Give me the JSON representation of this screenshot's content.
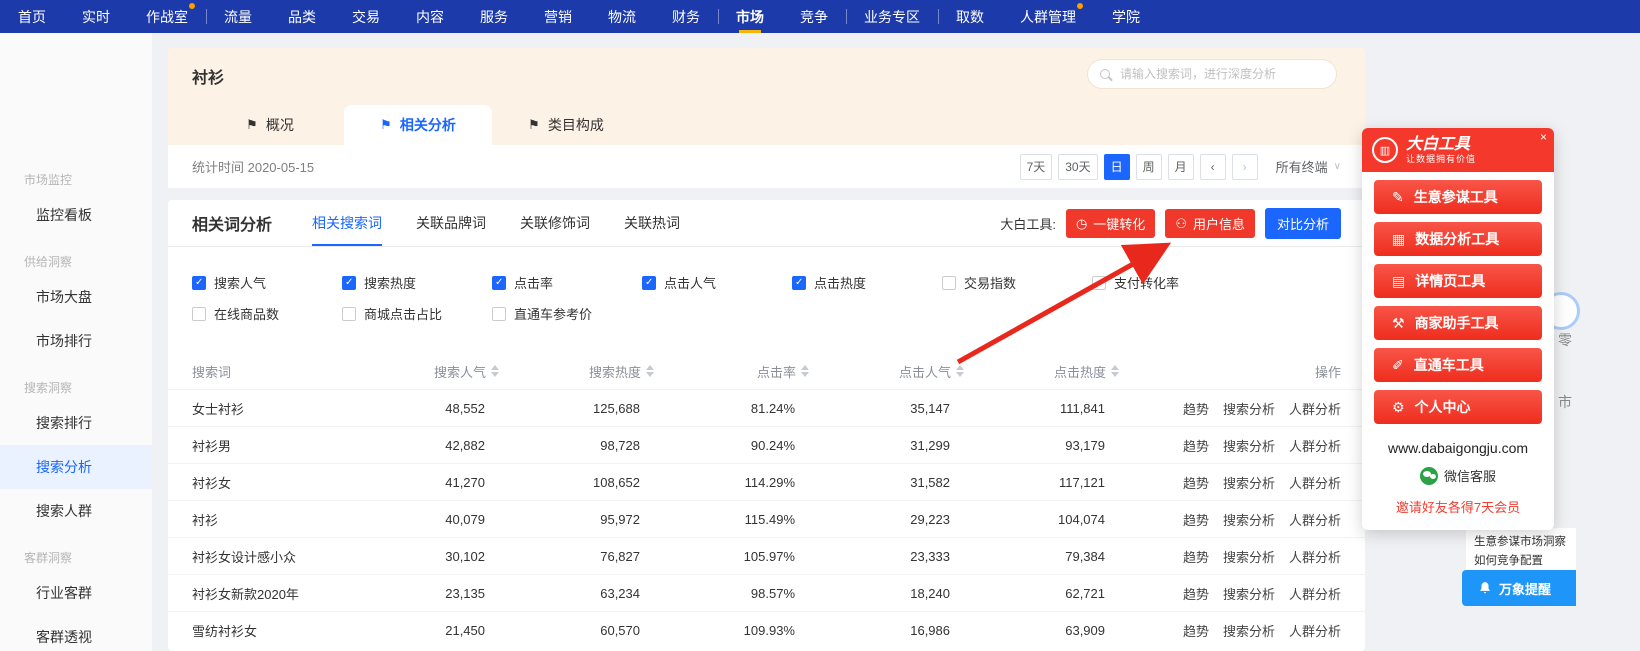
{
  "topnav": {
    "items": [
      {
        "label": "首页"
      },
      {
        "label": "实时"
      },
      {
        "label": "作战室",
        "badge": true
      },
      {
        "label": "流量",
        "divider": true
      },
      {
        "label": "品类"
      },
      {
        "label": "交易"
      },
      {
        "label": "内容"
      },
      {
        "label": "服务"
      },
      {
        "label": "营销"
      },
      {
        "label": "物流"
      },
      {
        "label": "财务"
      },
      {
        "label": "市场",
        "divider": true,
        "active": true
      },
      {
        "label": "竞争"
      },
      {
        "label": "业务专区",
        "divider": true
      },
      {
        "label": "取数",
        "divider": true
      },
      {
        "label": "人群管理",
        "badge": true
      },
      {
        "label": "学院"
      }
    ]
  },
  "sidebar": {
    "rows": [
      {
        "label": "市场监控",
        "is_header": true,
        "inter": "false"
      },
      {
        "label": "监控看板",
        "inter": "true"
      },
      {
        "label": "供给洞察",
        "is_header": true,
        "inter": "false"
      },
      {
        "label": "市场大盘",
        "inter": "true"
      },
      {
        "label": "市场排行",
        "inter": "true"
      },
      {
        "label": "搜索洞察",
        "is_header": true,
        "inter": "false"
      },
      {
        "label": "搜索排行",
        "inter": "true"
      },
      {
        "label": "搜索分析",
        "active": true,
        "inter": "true"
      },
      {
        "label": "搜索人群",
        "inter": "true"
      },
      {
        "label": "客群洞察",
        "is_header": true,
        "inter": "false"
      },
      {
        "label": "行业客群",
        "inter": "true"
      },
      {
        "label": "客群透视",
        "inter": "true"
      }
    ]
  },
  "hero": {
    "keyword": "衬衫",
    "search_placeholder": "请输入搜索词，进行深度分析",
    "tab_flag_glyph": "⚑",
    "tabs": [
      {
        "label": "概况"
      },
      {
        "label": "相关分析",
        "active": true
      },
      {
        "label": "类目构成"
      }
    ]
  },
  "toolbar": {
    "stat_time": "统计时间 2020-05-15",
    "date_buttons": [
      {
        "label": "7天"
      },
      {
        "label": "30天"
      },
      {
        "label": "日",
        "active": true
      },
      {
        "label": "周"
      },
      {
        "label": "月"
      }
    ],
    "prev_glyph": "‹",
    "next_glyph": "›",
    "terminal": "所有终端",
    "caret_glyph": "∨"
  },
  "analysis": {
    "title": "相关词分析",
    "tabs": [
      {
        "label": "相关搜索词",
        "active": true
      },
      {
        "label": "关联品牌词"
      },
      {
        "label": "关联修饰词"
      },
      {
        "label": "关联热词"
      }
    ],
    "tools_label": "大白工具:",
    "tools": [
      {
        "label": "一键转化",
        "name": "one-key-convert-button",
        "icon_name": "one-key-convert-icon",
        "icon_glyph": "◷",
        "has_icon": true
      },
      {
        "label": "用户信息",
        "name": "user-info-button",
        "icon_name": "user-info-icon",
        "icon_glyph": "⚇",
        "has_icon": true
      },
      {
        "label": "对比分析",
        "name": "compare-analysis-button",
        "is_blue": true
      }
    ],
    "metrics": [
      {
        "label": "搜索人气",
        "checked": true
      },
      {
        "label": "搜索热度",
        "checked": true
      },
      {
        "label": "点击率",
        "checked": true
      },
      {
        "label": "点击人气",
        "checked": true
      },
      {
        "label": "点击热度",
        "checked": true
      },
      {
        "label": "交易指数"
      },
      {
        "label": "支付转化率"
      },
      {
        "label": "在线商品数"
      },
      {
        "label": "商城点击占比"
      },
      {
        "label": "直通车参考价"
      }
    ]
  },
  "table": {
    "columns": [
      {
        "label": "搜索词"
      },
      {
        "label": "搜索人气",
        "sortable": true
      },
      {
        "label": "搜索热度",
        "sortable": true
      },
      {
        "label": "点击率",
        "sortable": true
      },
      {
        "label": "点击人气",
        "sortable": true
      },
      {
        "label": "点击热度",
        "sortable": true
      },
      {
        "label": "操作"
      }
    ],
    "actions": [
      "趋势",
      "搜索分析",
      "人群分析"
    ],
    "rows": [
      {
        "keyword": "女士衬衫",
        "values": [
          "48,552",
          "125,688",
          "81.24%",
          "35,147",
          "111,841"
        ]
      },
      {
        "keyword": "衬衫男",
        "values": [
          "42,882",
          "98,728",
          "90.24%",
          "31,299",
          "93,179"
        ]
      },
      {
        "keyword": "衬衫女",
        "values": [
          "41,270",
          "108,652",
          "114.29%",
          "31,582",
          "117,121"
        ]
      },
      {
        "keyword": "衬衫",
        "values": [
          "40,079",
          "95,972",
          "115.49%",
          "29,223",
          "104,074"
        ]
      },
      {
        "keyword": "衬衫女设计感小众",
        "values": [
          "30,102",
          "76,827",
          "105.97%",
          "23,333",
          "79,384"
        ]
      },
      {
        "keyword": "衬衫女新款2020年",
        "values": [
          "23,135",
          "63,234",
          "98.57%",
          "18,240",
          "62,721"
        ]
      },
      {
        "keyword": "雪纺衬衫女",
        "values": [
          "21,450",
          "60,570",
          "109.93%",
          "16,986",
          "63,909"
        ]
      }
    ]
  },
  "plugin": {
    "title": "大白工具",
    "subtitle": "让数据拥有价值",
    "logo_glyph": "▥",
    "collapse_glyph": "×",
    "buttons": [
      {
        "label": "生意参谋工具",
        "name": "advisor-tool-button",
        "icon_name": "pencil-icon",
        "icon_glyph": "✎"
      },
      {
        "label": "数据分析工具",
        "name": "data-analysis-tool-button",
        "icon_name": "chart-icon",
        "icon_glyph": "▦"
      },
      {
        "label": "详情页工具",
        "name": "detail-page-tool-button",
        "icon_name": "document-icon",
        "icon_glyph": "▤"
      },
      {
        "label": "商家助手工具",
        "name": "merchant-assistant-tool-button",
        "icon_name": "hammer-icon",
        "icon_glyph": "⚒"
      },
      {
        "label": "直通车工具",
        "name": "express-train-tool-button",
        "icon_name": "pen-icon",
        "icon_glyph": "✐"
      },
      {
        "label": "个人中心",
        "name": "personal-center-button",
        "icon_name": "gear-icon",
        "icon_glyph": "⚙"
      }
    ],
    "website": "www.dabaigongju.com",
    "wechat_label": "微信客服",
    "invite": "邀请好友各得7天会员"
  },
  "corner": {
    "line1": "生意参谋市场洞察",
    "line2": "如何竞争配置",
    "reminder": "万象提醒"
  },
  "edge": {
    "glyph_top": "零",
    "glyph_bottom": "市"
  },
  "colors": {
    "nav_blue": "#1c3aa9",
    "accent_blue": "#1a66ff",
    "brand_red": "#f23d31",
    "active_yellow": "#f5b50a",
    "arrow_red": "#e8281c",
    "reminder_blue": "#1e95f8",
    "hero_peach": "#fdf2e6"
  }
}
